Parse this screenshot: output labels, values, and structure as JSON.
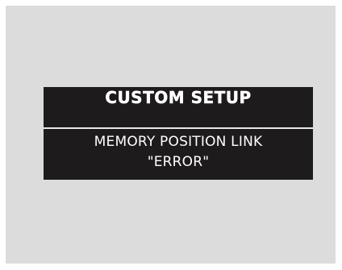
{
  "screen": {
    "header_title": "CUSTOM SETUP",
    "message_line_1": "MEMORY POSITION LINK",
    "message_line_2": "\"ERROR\""
  },
  "colors": {
    "panel_background": "#dcdcdc",
    "display_background": "#1e1b1c",
    "text": "#ffffff",
    "divider": "#e8e8e8"
  }
}
